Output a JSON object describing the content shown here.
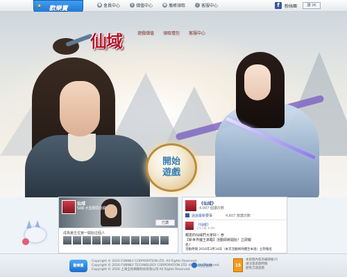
{
  "topbar": {
    "logo_text": "歡樂賣",
    "nav": [
      {
        "label": "會員中心",
        "icon": "user-icon"
      },
      {
        "label": "儲值中心",
        "icon": "coin-icon"
      },
      {
        "label": "攜帳領取",
        "icon": "gift-icon"
      },
      {
        "label": "客服中心",
        "icon": "headset-icon"
      }
    ],
    "fb_text": "粉絲團",
    "like_label": "讚 2K"
  },
  "game": {
    "title": "仙域",
    "nav": [
      "遊戲儲值",
      "領取禮包",
      "客服中心"
    ],
    "start_line1": "開始",
    "start_line2": "遊戲"
  },
  "fbcard": {
    "name": "仙域",
    "sub": "仙域-大型網頁遊戲",
    "like_label": "已讚",
    "count_text": "成為第五位第一開始這個人"
  },
  "feed": {
    "page_name": "《仙域》",
    "page_sub": "4,007 個讚次數",
    "fb_label": "說說最新要事",
    "fb_label2": "4,607 按讚次數",
    "post_name": "《仙域》",
    "post_time": "2/17日 4:49",
    "line1": "親愛的仙域們大家好~ 😎",
    "line2": "【新世界魔王來臨】活動即將開始！立即報",
    "line3": "名！",
    "line4": "活動時間 2016年3月14日（本次活動將持續至本週）立刻報名"
  },
  "footer": {
    "logo_text": "歡樂賣",
    "copy1": "Copyright © 2016 FUNNILY CORPORATION LTD. All Rights Reserved.",
    "copy2": "Copyright © 2016 FUNNILY TECHNOLOGY CORPORATION LTD. All Rights Reserved.",
    "copy3": "Copyright © 2016 上海全民網路科技有限公司 All Rights Reserved.",
    "partner": "北極信數",
    "rating": "15",
    "note1": "本遊戲內容為輔導級15",
    "note2": "請注意遊戲時間",
    "note3": "避免沉迷遊戲"
  }
}
